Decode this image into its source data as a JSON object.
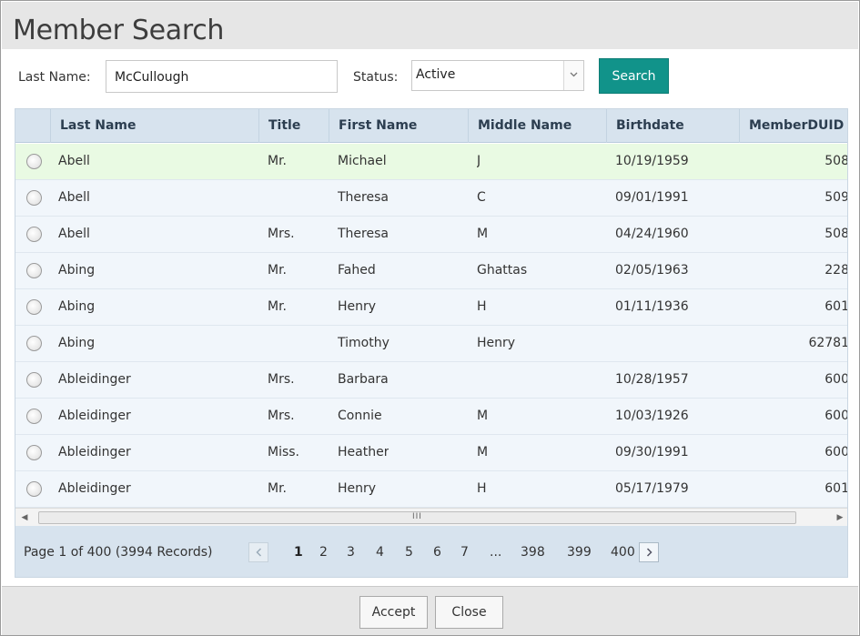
{
  "dialog": {
    "title": "Member Search"
  },
  "filters": {
    "last_name_label": "Last Name:",
    "last_name_value": "McCullough",
    "status_label": "Status:",
    "status_value": "Active",
    "search_label": "Search"
  },
  "grid": {
    "columns": [
      "Last Name",
      "Title",
      "First Name",
      "Middle Name",
      "Birthdate",
      "MemberDUID"
    ],
    "rows": [
      {
        "last": "Abell",
        "title": "Mr.",
        "first": "Michael",
        "middle": "J",
        "birth": "10/19/1959",
        "duid": "508",
        "selected": true
      },
      {
        "last": "Abell",
        "title": "",
        "first": "Theresa",
        "middle": "C",
        "birth": "09/01/1991",
        "duid": "509",
        "selected": false
      },
      {
        "last": "Abell",
        "title": "Mrs.",
        "first": "Theresa",
        "middle": "M",
        "birth": "04/24/1960",
        "duid": "508",
        "selected": false
      },
      {
        "last": "Abing",
        "title": "Mr.",
        "first": "Fahed",
        "middle": "Ghattas",
        "birth": "02/05/1963",
        "duid": "228",
        "selected": false
      },
      {
        "last": "Abing",
        "title": "Mr.",
        "first": "Henry",
        "middle": "H",
        "birth": "01/11/1936",
        "duid": "601",
        "selected": false
      },
      {
        "last": "Abing",
        "title": "",
        "first": "Timothy",
        "middle": "Henry",
        "birth": "",
        "duid": "62781",
        "selected": false
      },
      {
        "last": "Ableidinger",
        "title": "Mrs.",
        "first": "Barbara",
        "middle": "",
        "birth": "10/28/1957",
        "duid": "600",
        "selected": false
      },
      {
        "last": "Ableidinger",
        "title": "Mrs.",
        "first": "Connie",
        "middle": "M",
        "birth": "10/03/1926",
        "duid": "600",
        "selected": false
      },
      {
        "last": "Ableidinger",
        "title": "Miss.",
        "first": "Heather",
        "middle": "M",
        "birth": "09/30/1991",
        "duid": "600",
        "selected": false
      },
      {
        "last": "Ableidinger",
        "title": "Mr.",
        "first": "Henry",
        "middle": "H",
        "birth": "05/17/1979",
        "duid": "601",
        "selected": false
      }
    ],
    "scroll_grip": "III"
  },
  "pager": {
    "info": "Page 1 of 400 (3994 Records)",
    "pages": [
      "1",
      "2",
      "3",
      "4",
      "5",
      "6",
      "7",
      "...",
      "398",
      "399",
      "400"
    ],
    "current_page": "1"
  },
  "footer": {
    "accept_label": "Accept",
    "close_label": "Close"
  },
  "colors": {
    "accent": "#11938a",
    "header_bg": "#d7e3ee",
    "selected_row": "#e9fae3"
  }
}
